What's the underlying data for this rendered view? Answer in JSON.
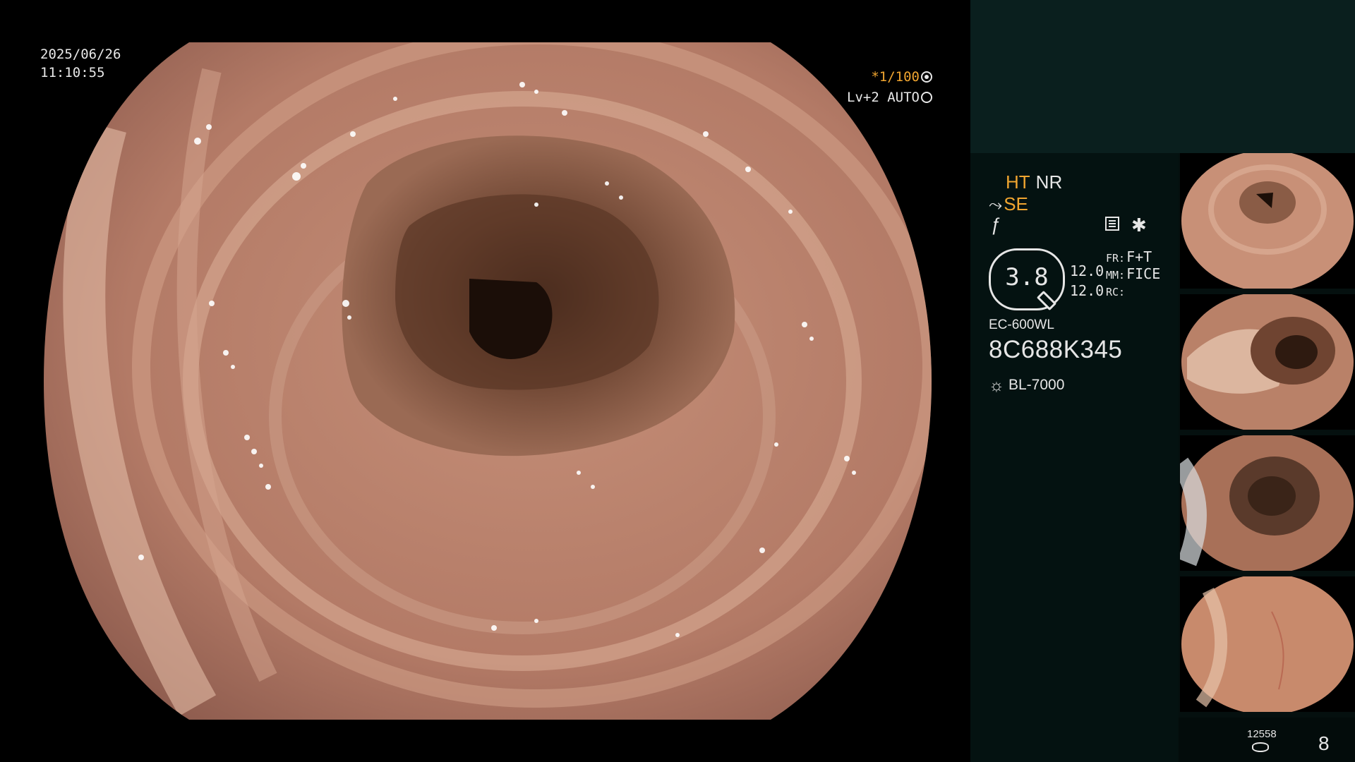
{
  "overlay": {
    "date": "2025/06/26",
    "time": "11:10:55",
    "shutter": "*1/100",
    "iris": "Lv+2 AUTO"
  },
  "panel": {
    "ht": "HT",
    "nr": "NR",
    "se": "SE",
    "zoom": "3.8",
    "value_1": "12.0",
    "value_2": "12.0",
    "fr_label": "FR:",
    "fr_value": "F+T",
    "mm_label": "MM:",
    "mm_value": "FICE",
    "rc_label": "RC:",
    "rc_value": "",
    "scope_model": "EC-600WL",
    "scope_serial": "8C688K345",
    "light_source": "BL-7000",
    "image_count": "12558",
    "capture_count": "8"
  },
  "icons": {
    "shutter": "shutter-icon",
    "iris": "iris-icon",
    "structure": "structure-icon",
    "freeze": "freeze-icon",
    "menu": "menu-icon",
    "light": "light-source-icon",
    "storage": "storage-icon"
  },
  "colors": {
    "accent": "#f0a530",
    "panel_bg": "#041211",
    "panel_top": "#0a1f1e",
    "text": "#e6e6e6"
  }
}
